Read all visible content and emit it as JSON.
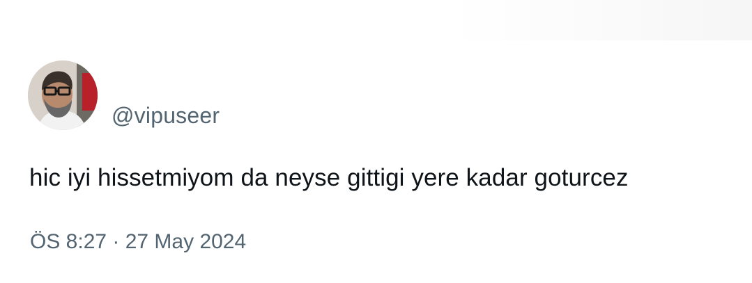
{
  "tweet": {
    "handle": "@vipuseer",
    "text": "hic iyi hissetmiyom da neyse gittigi yere kadar goturcez",
    "timestamp": "ÖS 8:27 · 27 May 2024"
  },
  "colors": {
    "text": "#0f1419",
    "secondary": "#536471",
    "background": "#ffffff"
  },
  "icons": {
    "avatar": "profile-photo"
  }
}
